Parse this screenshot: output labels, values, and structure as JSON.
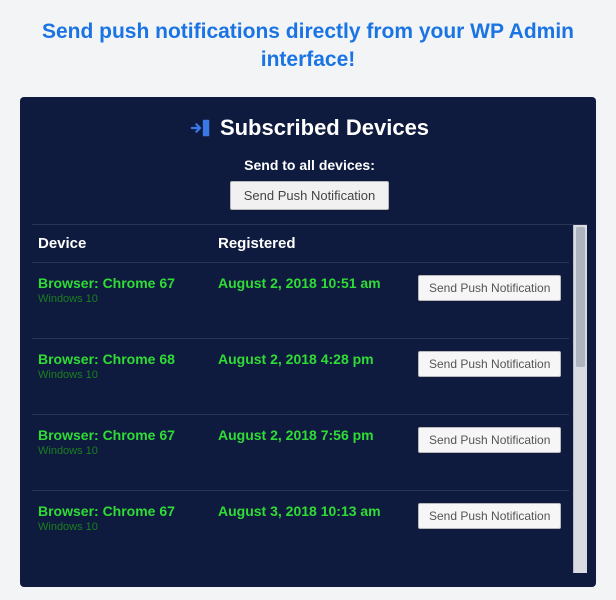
{
  "hero": "Send push notifications directly from your WP Admin interface!",
  "panel": {
    "title": "Subscribed Devices",
    "sendall_label": "Send to all devices:",
    "sendall_button": "Send Push Notification"
  },
  "table": {
    "headers": {
      "device": "Device",
      "registered": "Registered"
    },
    "row_button": "Send Push Notification",
    "rows": [
      {
        "browser": "Browser: Chrome 67",
        "os": "Windows 10",
        "registered": "August 2, 2018 10:51 am"
      },
      {
        "browser": "Browser: Chrome 68",
        "os": "Windows 10",
        "registered": "August 2, 2018 4:28 pm"
      },
      {
        "browser": "Browser: Chrome 67",
        "os": "Windows 10",
        "registered": "August 2, 2018 7:56 pm"
      },
      {
        "browser": "Browser: Chrome 67",
        "os": "Windows 10",
        "registered": "August 3, 2018 10:13 am"
      }
    ]
  }
}
